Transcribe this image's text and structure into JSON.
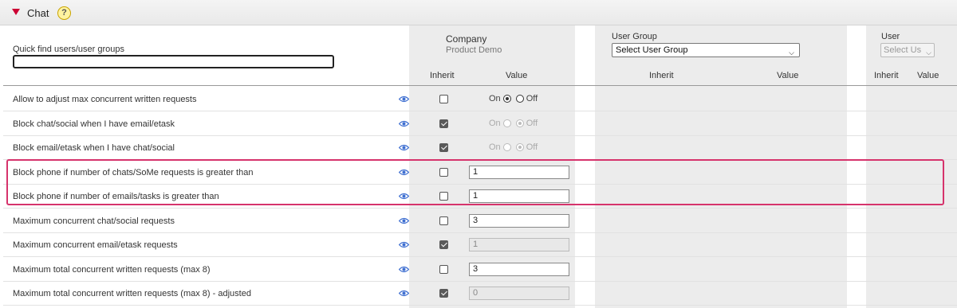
{
  "section": {
    "title": "Chat",
    "help_glyph": "?"
  },
  "quick_find": {
    "label": "Quick find users/user groups",
    "value": ""
  },
  "company": {
    "label": "Company",
    "name": "Product Demo"
  },
  "user_group": {
    "label": "User Group",
    "selected": "Select User Group"
  },
  "user": {
    "label": "User",
    "selected": "Select Us"
  },
  "columns": {
    "inherit": "Inherit",
    "value": "Value"
  },
  "radio_labels": {
    "on": "On",
    "off": "Off"
  },
  "rows": [
    {
      "label": "Allow to adjust max concurrent written requests",
      "inherit": false,
      "type": "radio",
      "value": "On",
      "disabled": false
    },
    {
      "label": "Block chat/social when I have email/etask",
      "inherit": true,
      "type": "radio",
      "value": "Off",
      "disabled": true
    },
    {
      "label": "Block email/etask when I have chat/social",
      "inherit": true,
      "type": "radio",
      "value": "Off",
      "disabled": true
    },
    {
      "label": "Block phone if number of chats/SoMe requests is greater than",
      "inherit": false,
      "type": "text",
      "value": "1",
      "disabled": false
    },
    {
      "label": "Block phone if number of emails/tasks is greater than",
      "inherit": false,
      "type": "text",
      "value": "1",
      "disabled": false
    },
    {
      "label": "Maximum concurrent chat/social requests",
      "inherit": false,
      "type": "text",
      "value": "3",
      "disabled": false
    },
    {
      "label": "Maximum concurrent email/etask requests",
      "inherit": true,
      "type": "text",
      "value": "1",
      "disabled": true
    },
    {
      "label": "Maximum total concurrent written requests (max 8)",
      "inherit": false,
      "type": "text",
      "value": "3",
      "disabled": false
    },
    {
      "label": "Maximum total concurrent written requests (max 8) - adjusted",
      "inherit": true,
      "type": "text",
      "value": "0",
      "disabled": true
    }
  ],
  "colors": {
    "caret": "#cc0033",
    "highlight": "#d6336c",
    "eye": "#3f6fd1",
    "column_bg": "#ececec"
  }
}
